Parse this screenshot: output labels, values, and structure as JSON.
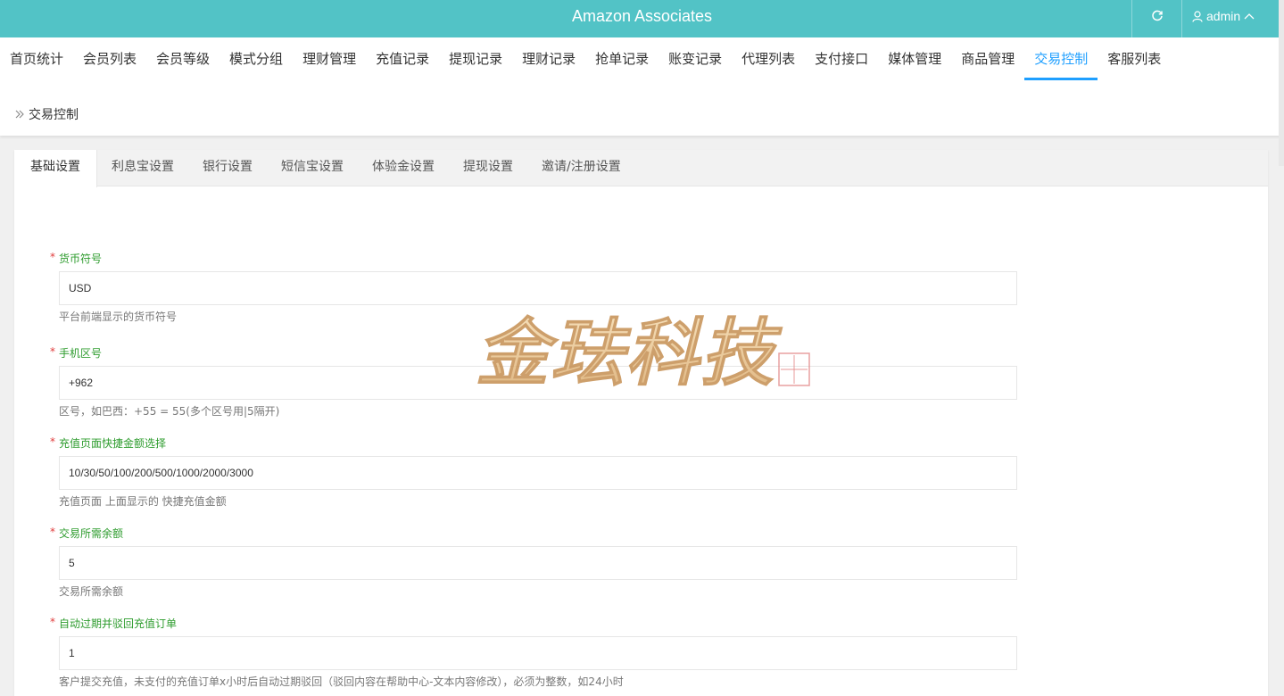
{
  "header": {
    "title": "Amazon Associates",
    "user_name": "admin",
    "brand_color": "#52c3c6",
    "accent_color": "#1e9fff"
  },
  "nav": {
    "items": [
      {
        "label": "首页统计"
      },
      {
        "label": "会员列表"
      },
      {
        "label": "会员等级"
      },
      {
        "label": "模式分组"
      },
      {
        "label": "理财管理"
      },
      {
        "label": "充值记录"
      },
      {
        "label": "提现记录"
      },
      {
        "label": "理财记录"
      },
      {
        "label": "抢单记录"
      },
      {
        "label": "账变记录"
      },
      {
        "label": "代理列表"
      },
      {
        "label": "支付接口"
      },
      {
        "label": "媒体管理"
      },
      {
        "label": "商品管理"
      },
      {
        "label": "交易控制",
        "active": true
      },
      {
        "label": "客服列表"
      }
    ]
  },
  "breadcrumb": {
    "current": "交易控制"
  },
  "tabs": [
    {
      "label": "基础设置",
      "active": true
    },
    {
      "label": "利息宝设置"
    },
    {
      "label": "银行设置"
    },
    {
      "label": "短信宝设置"
    },
    {
      "label": "体验金设置"
    },
    {
      "label": "提现设置"
    },
    {
      "label": "邀请/注册设置"
    }
  ],
  "form": {
    "required_mark": "*",
    "fields": [
      {
        "label": "货币符号",
        "value": "USD",
        "help": "平台前端显示的货币符号"
      },
      {
        "label": "手机区号",
        "value": "+962",
        "help": "区号，如巴西：+55 = 55(多个区号用|5隔开)"
      },
      {
        "label": "充值页面快捷金额选择",
        "value": "10/30/50/100/200/500/1000/2000/3000",
        "help": "充值页面 上面显示的 快捷充值金额"
      },
      {
        "label": "交易所需余额",
        "value": "5",
        "help": "交易所需余额"
      },
      {
        "label": "自动过期并驳回充值订单",
        "value": "1",
        "help": "客户提交充值，未支付的充值订单x小时后自动过期驳回（驳回内容在帮助中心-文本内容修改），必须为整数，如24小时"
      }
    ]
  },
  "watermark": {
    "text": "金珐科技"
  },
  "icons": {
    "refresh": "refresh-icon",
    "user": "user-icon",
    "caret": "chevron-up-icon",
    "breadcrumb": "double-chevron-right-icon"
  }
}
